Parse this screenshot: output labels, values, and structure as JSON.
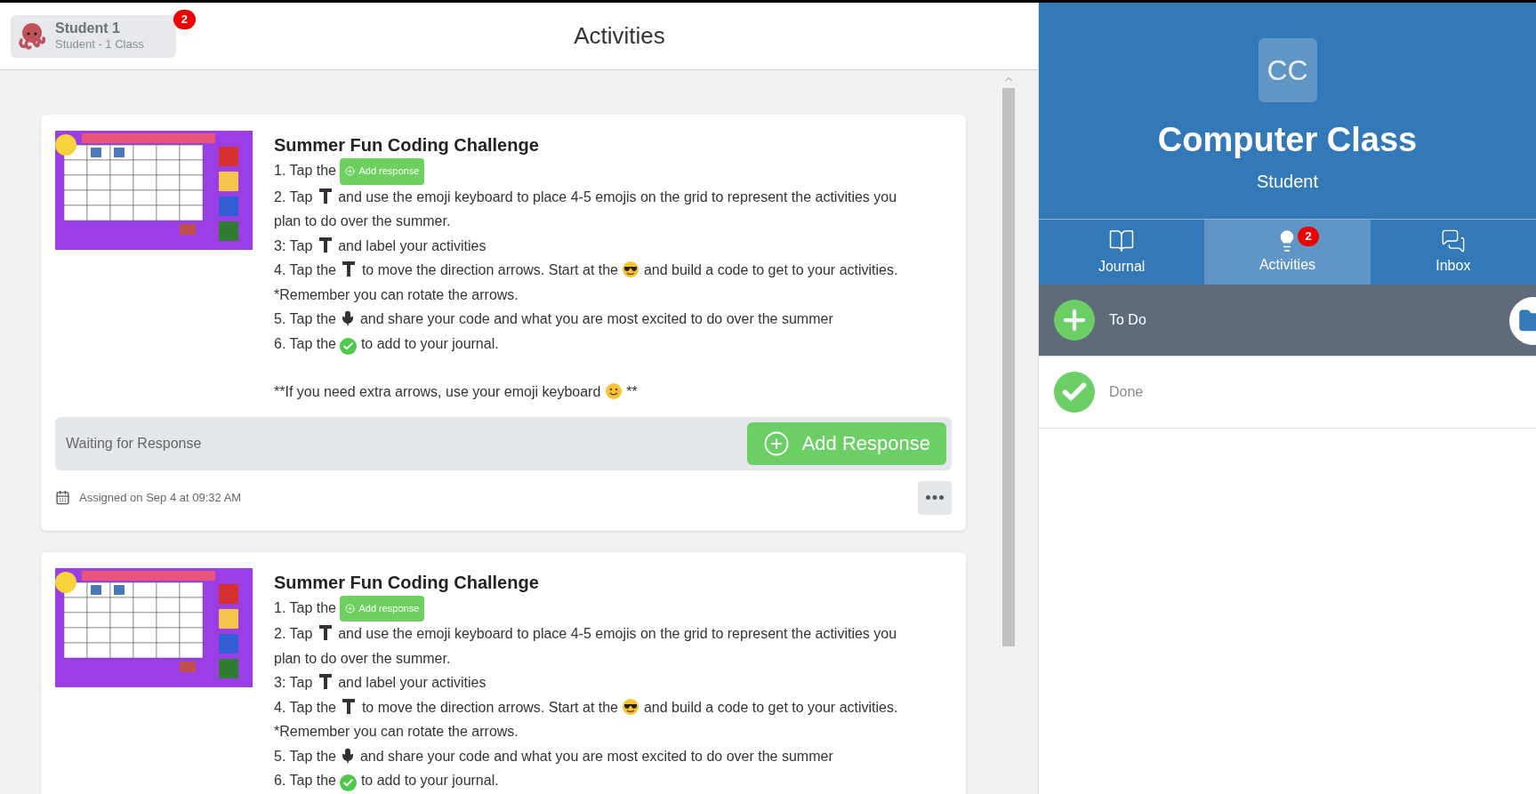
{
  "user": {
    "name": "Student 1",
    "subtitle": "Student - 1 Class",
    "badge": "2"
  },
  "page_title": "Activities",
  "activities": [
    {
      "title": "Summer Fun Coding Challenge",
      "steps": [
        [
          {
            "kind": "text",
            "text": "1. Tap the "
          },
          {
            "kind": "chip",
            "text": "Add response"
          }
        ],
        [
          {
            "kind": "text",
            "text": "2. Tap "
          },
          {
            "kind": "text-tool"
          },
          {
            "kind": "text",
            "text": " and use the emoji keyboard to place 4-5 emojis on the grid to represent the activities you plan to do over the summer."
          }
        ],
        [
          {
            "kind": "text",
            "text": "3: Tap "
          },
          {
            "kind": "text-tool"
          },
          {
            "kind": "text",
            "text": " and label your activities"
          }
        ],
        [
          {
            "kind": "text",
            "text": "4. Tap the "
          },
          {
            "kind": "text-tool"
          },
          {
            "kind": "text",
            "text": " to move the direction arrows. Start at the "
          },
          {
            "kind": "sunglasses"
          },
          {
            "kind": "text",
            "text": " and build a code to get to your activities. *Remember you can rotate the arrows."
          }
        ],
        [
          {
            "kind": "text",
            "text": "5. Tap the "
          },
          {
            "kind": "mic"
          },
          {
            "kind": "text",
            "text": " and share your code and what you are most excited to do over the summer"
          }
        ],
        [
          {
            "kind": "text",
            "text": "6. Tap the "
          },
          {
            "kind": "check"
          },
          {
            "kind": "text",
            "text": " to add to your journal."
          }
        ]
      ],
      "note": [
        {
          "kind": "text",
          "text": "**If you need extra arrows, use your emoji keyboard "
        },
        {
          "kind": "smile"
        },
        {
          "kind": "text",
          "text": " **"
        }
      ],
      "status": "Waiting for Response",
      "action": "Add Response",
      "assigned": "Assigned on Sep 4 at 09:32 AM"
    },
    {
      "title": "Summer Fun Coding Challenge",
      "steps": [
        [
          {
            "kind": "text",
            "text": "1. Tap the "
          },
          {
            "kind": "chip",
            "text": "Add response"
          }
        ],
        [
          {
            "kind": "text",
            "text": "2. Tap "
          },
          {
            "kind": "text-tool"
          },
          {
            "kind": "text",
            "text": " and use the emoji keyboard to place 4-5 emojis on the grid to represent the activities you plan to do over the summer."
          }
        ],
        [
          {
            "kind": "text",
            "text": "3: Tap "
          },
          {
            "kind": "text-tool"
          },
          {
            "kind": "text",
            "text": " and label your activities"
          }
        ],
        [
          {
            "kind": "text",
            "text": "4. Tap the "
          },
          {
            "kind": "text-tool"
          },
          {
            "kind": "text",
            "text": " to move the direction arrows. Start at the "
          },
          {
            "kind": "sunglasses"
          },
          {
            "kind": "text",
            "text": " and build a code to get to your activities. *Remember you can rotate the arrows."
          }
        ],
        [
          {
            "kind": "text",
            "text": "5. Tap the "
          },
          {
            "kind": "mic"
          },
          {
            "kind": "text",
            "text": " and share your code and what you are most excited to do over the summer"
          }
        ],
        [
          {
            "kind": "text",
            "text": "6. Tap the "
          },
          {
            "kind": "check"
          },
          {
            "kind": "text",
            "text": " to add to your journal."
          }
        ]
      ]
    }
  ],
  "class": {
    "initials": "CC",
    "name": "Computer Class",
    "role": "Student"
  },
  "tabs": [
    {
      "label": "Journal",
      "selected": false,
      "kind": "journal"
    },
    {
      "label": "Activities",
      "selected": true,
      "kind": "activities",
      "badge": "2"
    },
    {
      "label": "Inbox",
      "selected": false,
      "kind": "inbox"
    }
  ],
  "filters": [
    {
      "label": "To Do",
      "selected": true,
      "kind": "todo"
    },
    {
      "label": "Done",
      "selected": false,
      "kind": "done"
    }
  ]
}
